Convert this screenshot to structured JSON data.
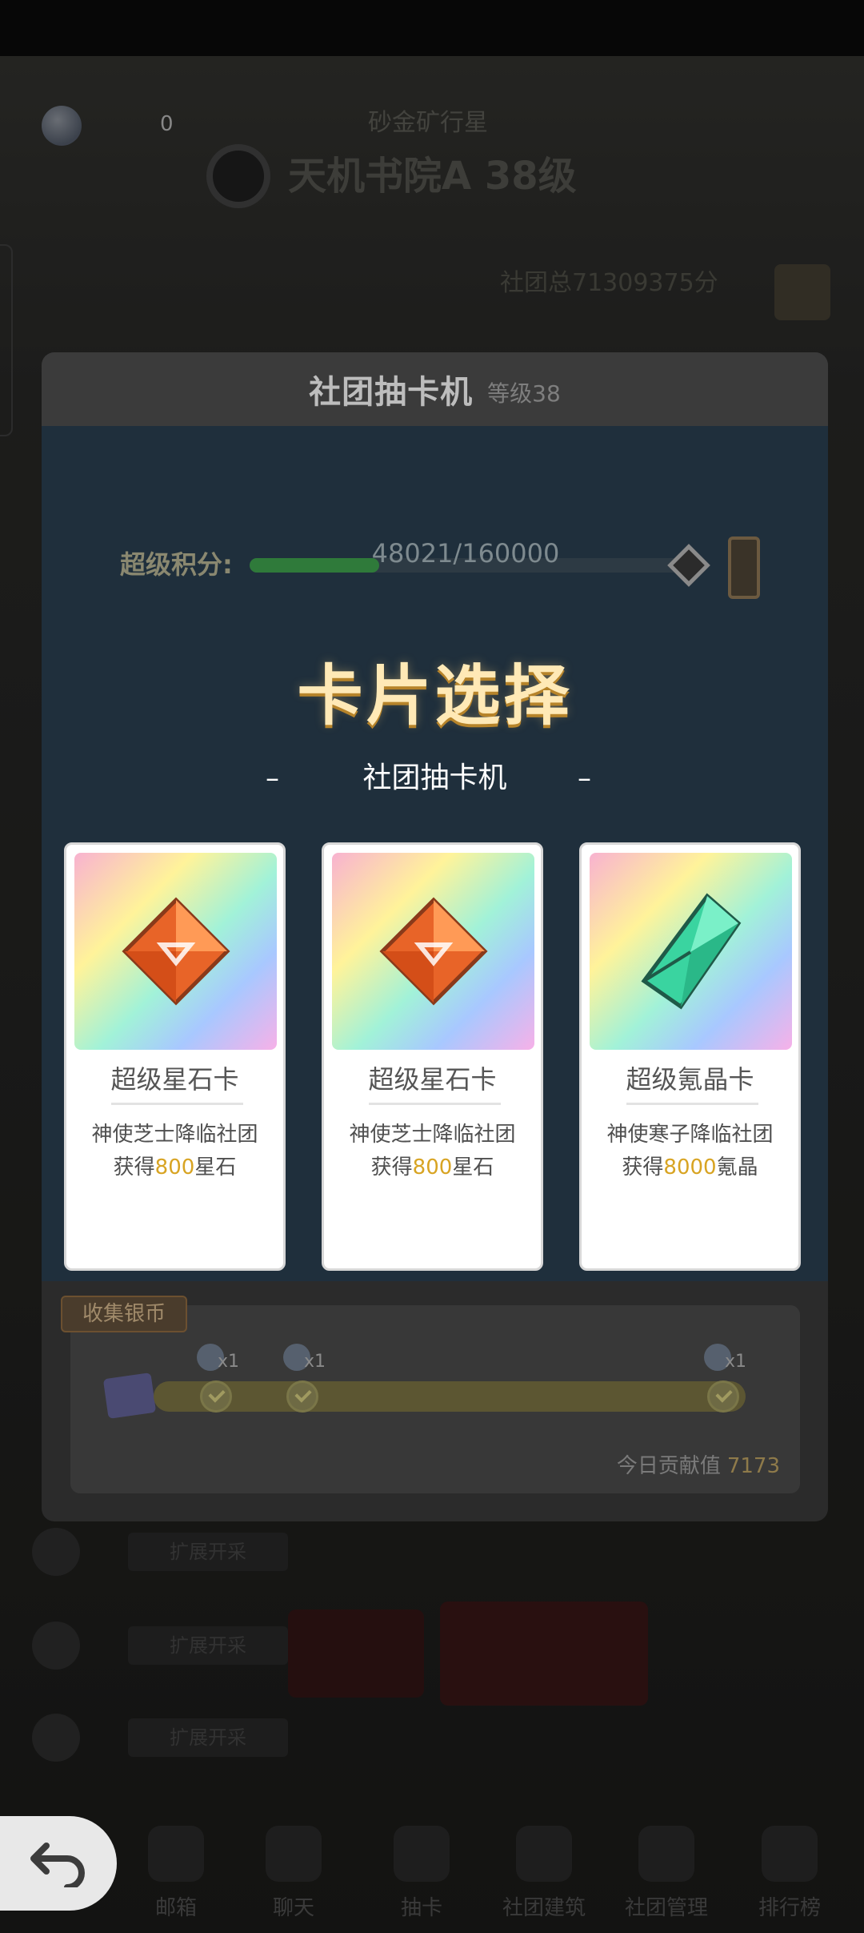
{
  "background": {
    "coin_count": "0",
    "subtitle": "砂金矿行星",
    "clan_name": "天机书院A 38级",
    "clan_score": "社团总71309375分",
    "rows": [
      {
        "label": "扩展开采"
      },
      {
        "label": "扩展开采"
      },
      {
        "label": "扩展开采"
      }
    ]
  },
  "bottom_nav": {
    "items": [
      {
        "label": "邮箱",
        "icon": "mail-icon"
      },
      {
        "label": "聊天",
        "icon": "chat-icon"
      },
      {
        "label": "抽卡",
        "icon": "gacha-icon"
      },
      {
        "label": "社团建筑",
        "icon": "building-icon"
      },
      {
        "label": "社团管理",
        "icon": "members-icon"
      },
      {
        "label": "排行榜",
        "icon": "ranking-icon"
      }
    ],
    "back_icon": "back-arrow-icon"
  },
  "modal": {
    "title": "社团抽卡机",
    "level": "等级38",
    "points_label": "超级积分:",
    "progress": {
      "current": 48021,
      "max": 160000,
      "text": "48021/160000"
    },
    "card_select_title": "卡片选择",
    "sub_title": "社团抽卡机",
    "dash_left": "–",
    "dash_right": "–",
    "cards": [
      {
        "name": "超级星石卡",
        "desc": "神使芝士降临社团",
        "reward_prefix": "获得",
        "reward_amount": "800",
        "reward_unit": "星石",
        "icon": "star-stone-icon"
      },
      {
        "name": "超级星石卡",
        "desc": "神使芝士降临社团",
        "reward_prefix": "获得",
        "reward_amount": "800",
        "reward_unit": "星石",
        "icon": "star-stone-icon"
      },
      {
        "name": "超级氪晶卡",
        "desc": "神使寒子降临社团",
        "reward_prefix": "获得",
        "reward_amount": "8000",
        "reward_unit": "氪晶",
        "icon": "krypton-crystal-icon"
      }
    ],
    "collect": {
      "tag": "收集银币",
      "nodes": [
        {
          "reward": "x1"
        },
        {
          "reward": "x1"
        },
        {
          "reward": "x1"
        }
      ],
      "contribution_label": "今日贡献值",
      "contribution_value": "7173"
    }
  },
  "colors": {
    "accent_gold": "#d8a423",
    "modal_body": "#1f2f3c",
    "title_glow": "#ffe9b6"
  }
}
